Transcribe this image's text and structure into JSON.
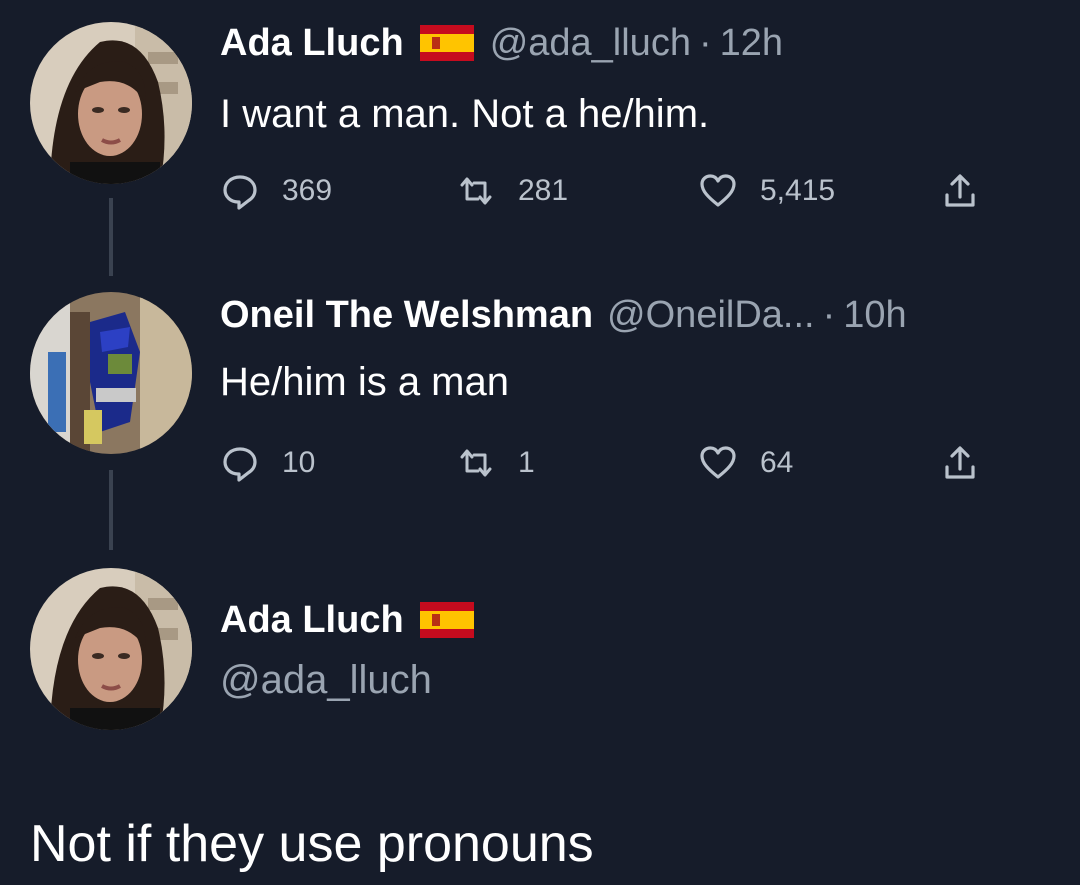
{
  "tweets": [
    {
      "name": "Ada Lluch",
      "handle": "@ada_lluch",
      "separator": "·",
      "time": "12h",
      "text": "I want a man. Not a he/him.",
      "replies": "369",
      "retweets": "281",
      "likes": "5,415"
    },
    {
      "name": "Oneil The Welshman",
      "handle": "@OneilDa...",
      "separator": "·",
      "time": "10h",
      "text": "He/him is a man",
      "replies": "10",
      "retweets": "1",
      "likes": "64"
    }
  ],
  "reply": {
    "name": "Ada Lluch",
    "handle": "@ada_lluch",
    "text": "Not if they use pronouns"
  },
  "icons": {
    "reply": "speech-bubble-icon",
    "retweet": "retweet-arrows-icon",
    "like": "heart-icon",
    "share": "share-upload-icon",
    "flag": "spain-flag-icon"
  },
  "colors": {
    "background": "#161c2a",
    "text_primary": "#ffffff",
    "text_secondary": "#9aa4b1",
    "icon": "#bac2cc",
    "thread_line": "#3a4250"
  }
}
